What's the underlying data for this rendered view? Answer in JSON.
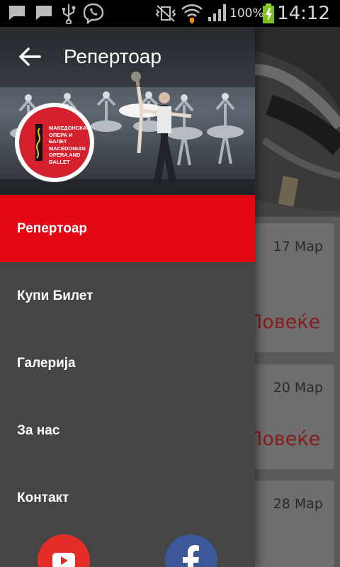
{
  "status_bar": {
    "battery_percent": "100%",
    "time": "14:12"
  },
  "drawer": {
    "title": "Репертоар",
    "logo_text": [
      "МАКЕДОНСКА",
      "ОПЕРА И",
      "БАЛЕТ",
      "MACEDONIAN",
      "OPERA AND",
      "BALLET"
    ],
    "menu": [
      {
        "label": "Репертоар",
        "active": true
      },
      {
        "label": "Купи Билет",
        "active": false
      },
      {
        "label": "Галерија",
        "active": false
      },
      {
        "label": "За нас",
        "active": false
      },
      {
        "label": "Контакт",
        "active": false
      }
    ],
    "social": [
      {
        "icon": "youtube-icon"
      },
      {
        "icon": "facebook-icon"
      }
    ]
  },
  "background": {
    "cards": [
      {
        "date": "17 Мар",
        "more": "Повеќе"
      },
      {
        "date": "20 Мар",
        "more": "Повеќе"
      },
      {
        "date": "28 Мар",
        "more": ""
      }
    ]
  },
  "colors": {
    "accent": "#e30613",
    "drawer_bg": "#454545",
    "youtube": "#e52d27",
    "facebook": "#3b5998"
  }
}
